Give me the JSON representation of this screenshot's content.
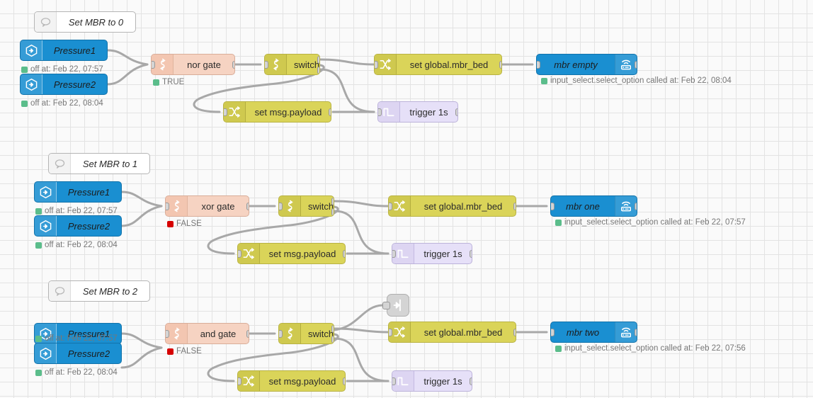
{
  "canvas": {
    "background": "#fafafa",
    "grid_color": "#e3e3e3",
    "grid_size": 20
  },
  "palette": {
    "ha_blue": "#1a8fd1",
    "logic_peach": "#f6d3c2",
    "function_yellow": "#dad459",
    "trigger_lavender": "#e6e0f8",
    "link_gray": "#d4d4d4",
    "status_green": "#5bbd8b",
    "status_red": "#d60000"
  },
  "flows": [
    {
      "comment": {
        "label": "Set MBR to 0",
        "icon": "comment-icon"
      },
      "inputs": [
        {
          "label": "Pressure1",
          "icon": "home-assistant-icon",
          "status": "off at: Feb 22, 07:57",
          "status_color": "green"
        },
        {
          "label": "Pressure2",
          "icon": "home-assistant-icon",
          "status": "off at: Feb 22, 08:04",
          "status_color": "green"
        }
      ],
      "gate": {
        "label": "nor gate",
        "icon": "logic-gate-icon",
        "status": "TRUE",
        "status_color": "green"
      },
      "switch": {
        "label": "switch",
        "icon": "switch-icon"
      },
      "change": {
        "label": "set global.mbr_bed",
        "icon": "change-icon"
      },
      "payload": {
        "label": "set msg.payload",
        "icon": "change-icon"
      },
      "trigger": {
        "label": "trigger 1s",
        "icon": "trigger-icon"
      },
      "output": {
        "label": "mbr empty",
        "icon": "wifi-router-icon",
        "status": "input_select.select_option called at: Feb 22, 08:04",
        "status_color": "green"
      },
      "link_out": null
    },
    {
      "comment": {
        "label": "Set MBR to 1",
        "icon": "comment-icon"
      },
      "inputs": [
        {
          "label": "Pressure1",
          "icon": "home-assistant-icon",
          "status": "off at: Feb 22, 07:57",
          "status_color": "green"
        },
        {
          "label": "Pressure2",
          "icon": "home-assistant-icon",
          "status": "off at: Feb 22, 08:04",
          "status_color": "green"
        }
      ],
      "gate": {
        "label": "xor gate",
        "icon": "logic-gate-icon",
        "status": "FALSE",
        "status_color": "red"
      },
      "switch": {
        "label": "switch",
        "icon": "switch-icon"
      },
      "change": {
        "label": "set global.mbr_bed",
        "icon": "change-icon"
      },
      "payload": {
        "label": "set msg.payload",
        "icon": "change-icon"
      },
      "trigger": {
        "label": "trigger 1s",
        "icon": "trigger-icon"
      },
      "output": {
        "label": "mbr one",
        "icon": "wifi-router-icon",
        "status": "input_select.select_option called at: Feb 22, 07:57",
        "status_color": "green"
      },
      "link_out": null
    },
    {
      "comment": {
        "label": "Set MBR to 2",
        "icon": "comment-icon"
      },
      "inputs": [
        {
          "label": "Pressure1",
          "icon": "home-assistant-icon",
          "status": "off at: Feb 22, 07:57",
          "status_color": "green"
        },
        {
          "label": "Pressure2",
          "icon": "home-assistant-icon",
          "status": "off at: Feb 22, 08:04",
          "status_color": "green"
        }
      ],
      "gate": {
        "label": "and gate",
        "icon": "logic-gate-icon",
        "status": "FALSE",
        "status_color": "red"
      },
      "switch": {
        "label": "switch",
        "icon": "switch-icon"
      },
      "change": {
        "label": "set global.mbr_bed",
        "icon": "change-icon"
      },
      "payload": {
        "label": "set msg.payload",
        "icon": "change-icon"
      },
      "trigger": {
        "label": "trigger 1s",
        "icon": "trigger-icon"
      },
      "output": {
        "label": "mbr two",
        "icon": "wifi-router-icon",
        "status": "input_select.select_option called at: Feb 22, 07:56",
        "status_color": "green"
      },
      "link_out": {
        "label": "",
        "icon": "link-out-icon"
      }
    }
  ]
}
